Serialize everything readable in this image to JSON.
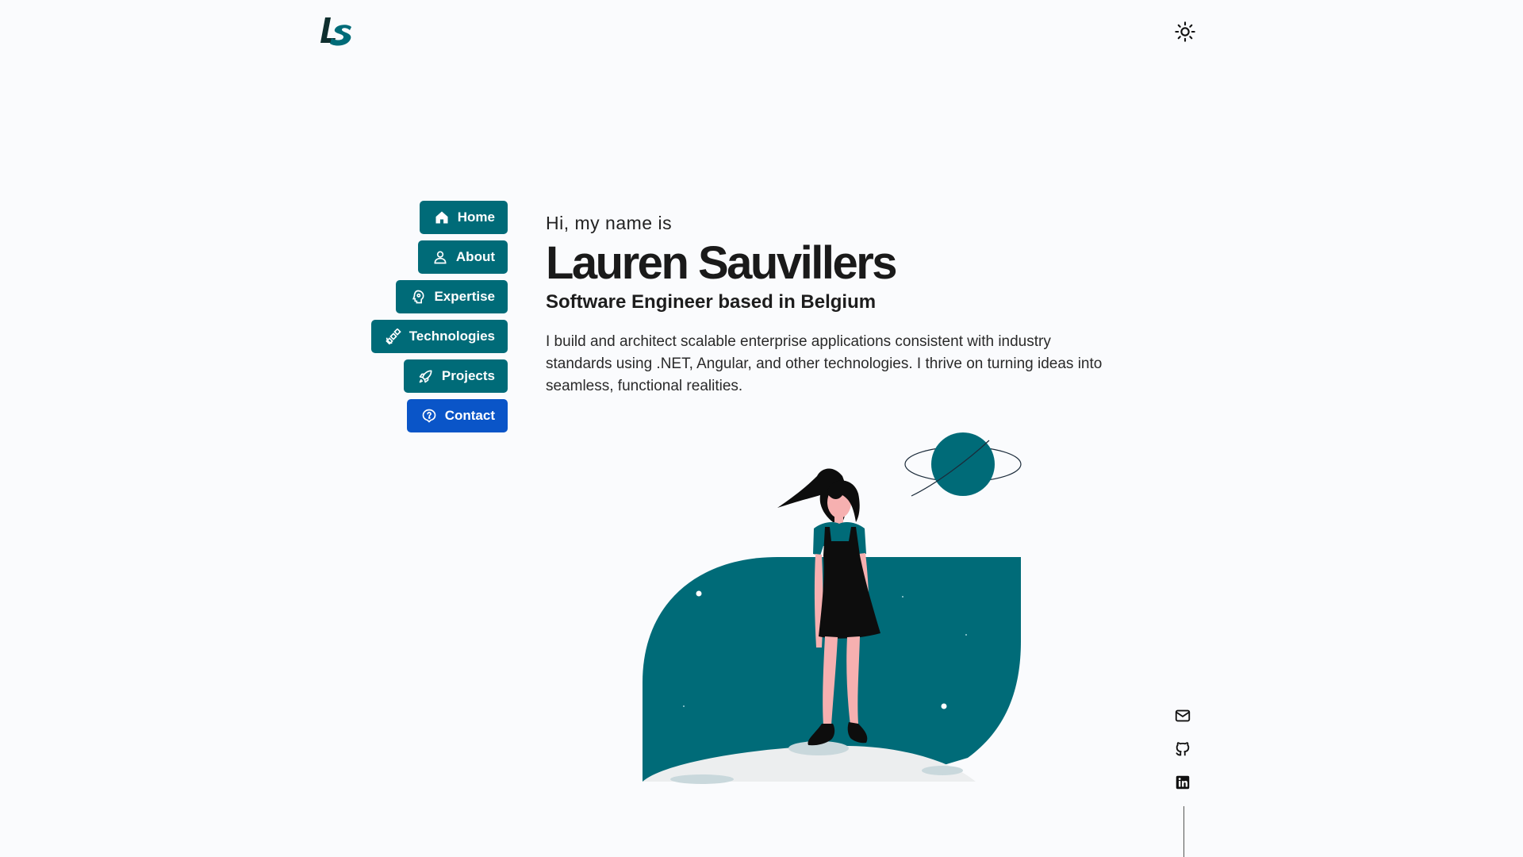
{
  "logo": {
    "text": "LS",
    "primary": "#0f2f2f",
    "accent": "#006b78"
  },
  "header": {
    "theme_toggle_icon": "sun-icon"
  },
  "nav": {
    "items": [
      {
        "label": "Home",
        "icon": "home-icon",
        "active": false
      },
      {
        "label": "About",
        "icon": "user-icon",
        "active": false
      },
      {
        "label": "Expertise",
        "icon": "expertise-icon",
        "active": false
      },
      {
        "label": "Technologies",
        "icon": "satellite-icon",
        "active": false
      },
      {
        "label": "Projects",
        "icon": "rocket-icon",
        "active": false
      },
      {
        "label": "Contact",
        "icon": "help-bubble-icon",
        "active": true
      }
    ]
  },
  "intro": {
    "greeting": "Hi, my name is",
    "name": "Lauren Sauvillers",
    "role": "Software Engineer based in Belgium",
    "bio": "I build and architect scalable enterprise applications consistent with industry standards using .NET, Angular, and other technologies. I thrive on turning ideas into seamless, functional realities."
  },
  "social": [
    "mail-icon",
    "github-icon",
    "linkedin-icon"
  ],
  "colors": {
    "teal": "#006b78",
    "active_blue": "#0a55c8",
    "background": "#fafbfd"
  }
}
